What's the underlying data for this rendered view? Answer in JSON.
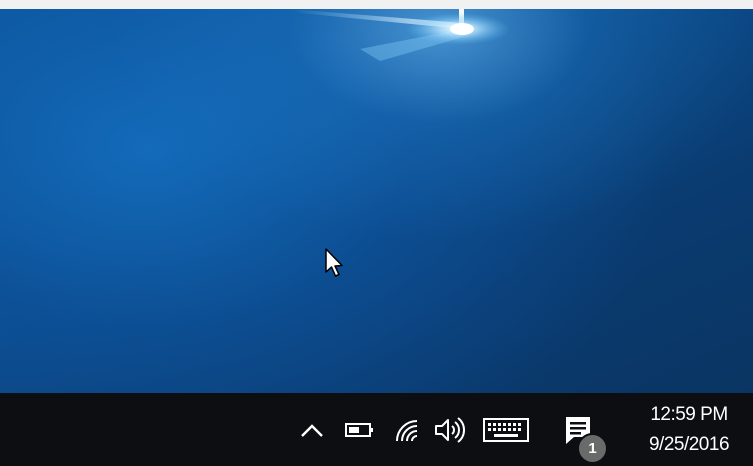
{
  "desktop": {
    "wallpaper": "windows-10-hero-blue",
    "accent_color": "#0b4c8d"
  },
  "cursor": {
    "icon": "arrow-cursor-icon"
  },
  "taskbar": {
    "background_color": "#0c0e11",
    "system_tray": {
      "icons": [
        {
          "name": "show-hidden-icons-chevron-icon"
        },
        {
          "name": "battery-icon"
        },
        {
          "name": "network-wifi-icon"
        },
        {
          "name": "volume-speaker-icon"
        },
        {
          "name": "touch-keyboard-icon"
        },
        {
          "name": "action-center-icon"
        }
      ],
      "notification_count": "1"
    },
    "clock": {
      "time": "12:59 PM",
      "date": "9/25/2016"
    }
  }
}
